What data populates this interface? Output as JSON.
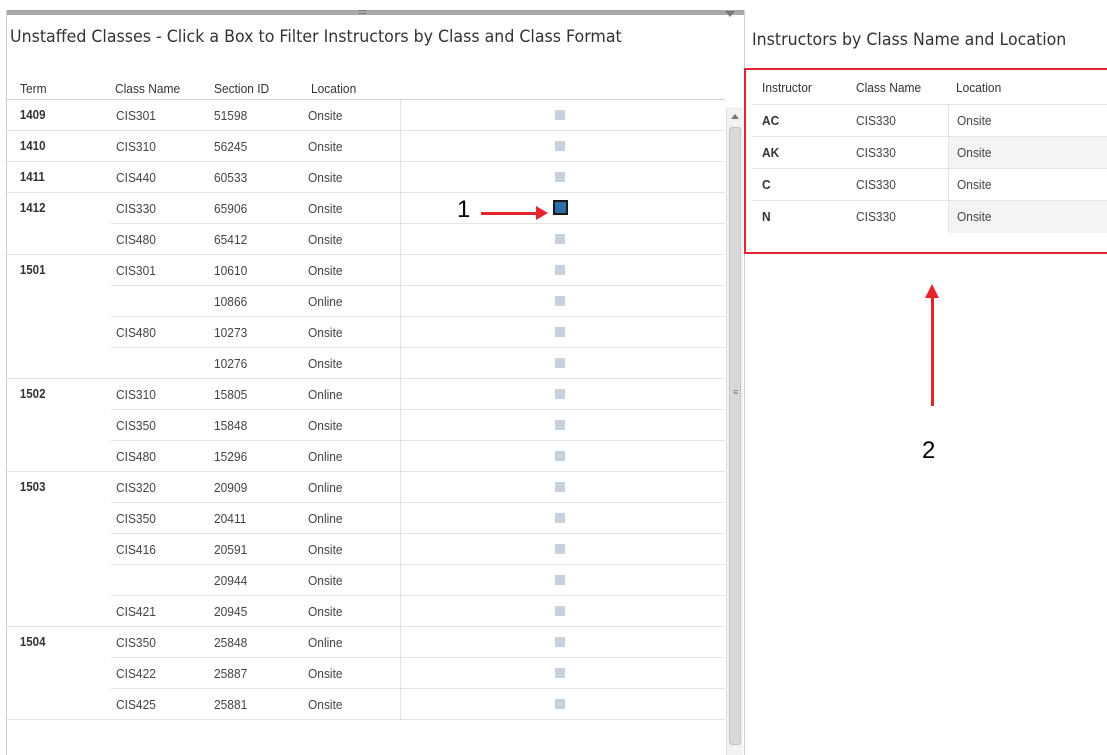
{
  "left_panel": {
    "title": "Unstaffed Classes - Click a Box to Filter Instructors by Class and Class Format",
    "headers": {
      "term": "Term",
      "class_name": "Class Name",
      "section_id": "Section ID",
      "location": "Location"
    },
    "term_groups": [
      {
        "term": "1409",
        "start": 0,
        "span": 1
      },
      {
        "term": "1410",
        "start": 1,
        "span": 1
      },
      {
        "term": "1411",
        "start": 2,
        "span": 1
      },
      {
        "term": "1412",
        "start": 3,
        "span": 2
      },
      {
        "term": "1501",
        "start": 5,
        "span": 4
      },
      {
        "term": "1502",
        "start": 9,
        "span": 3
      },
      {
        "term": "1503",
        "start": 12,
        "span": 5
      },
      {
        "term": "1504",
        "start": 17,
        "span": 3
      }
    ],
    "rows": [
      {
        "class_name": "CIS301",
        "section_id": "51598",
        "location": "Onsite",
        "selected": false
      },
      {
        "class_name": "CIS310",
        "section_id": "56245",
        "location": "Onsite",
        "selected": false
      },
      {
        "class_name": "CIS440",
        "section_id": "60533",
        "location": "Onsite",
        "selected": false
      },
      {
        "class_name": "CIS330",
        "section_id": "65906",
        "location": "Onsite",
        "selected": true
      },
      {
        "class_name": "CIS480",
        "section_id": "65412",
        "location": "Onsite",
        "selected": false
      },
      {
        "class_name": "CIS301",
        "section_id": "10610",
        "location": "Onsite",
        "selected": false
      },
      {
        "class_name": "",
        "section_id": "10866",
        "location": "Online",
        "selected": false
      },
      {
        "class_name": "CIS480",
        "section_id": "10273",
        "location": "Onsite",
        "selected": false
      },
      {
        "class_name": "",
        "section_id": "10276",
        "location": "Onsite",
        "selected": false
      },
      {
        "class_name": "CIS310",
        "section_id": "15805",
        "location": "Online",
        "selected": false
      },
      {
        "class_name": "CIS350",
        "section_id": "15848",
        "location": "Onsite",
        "selected": false
      },
      {
        "class_name": "CIS480",
        "section_id": "15296",
        "location": "Online",
        "selected": false
      },
      {
        "class_name": "CIS320",
        "section_id": "20909",
        "location": "Online",
        "selected": false
      },
      {
        "class_name": "CIS350",
        "section_id": "20411",
        "location": "Online",
        "selected": false
      },
      {
        "class_name": "CIS416",
        "section_id": "20591",
        "location": "Onsite",
        "selected": false
      },
      {
        "class_name": "",
        "section_id": "20944",
        "location": "Onsite",
        "selected": false
      },
      {
        "class_name": "CIS421",
        "section_id": "20945",
        "location": "Onsite",
        "selected": false
      },
      {
        "class_name": "CIS350",
        "section_id": "25848",
        "location": "Online",
        "selected": false
      },
      {
        "class_name": "CIS422",
        "section_id": "25887",
        "location": "Onsite",
        "selected": false
      },
      {
        "class_name": "CIS425",
        "section_id": "25881",
        "location": "Onsite",
        "selected": false
      }
    ]
  },
  "right_panel": {
    "title": "Instructors by Class Name and Location",
    "headers": {
      "instructor": "Instructor",
      "class_name": "Class Name",
      "location": "Location"
    },
    "rows": [
      {
        "instructor": "AC",
        "class_name": "CIS330",
        "location": "Onsite"
      },
      {
        "instructor": "AK",
        "class_name": "CIS330",
        "location": "Onsite"
      },
      {
        "instructor": "C",
        "class_name": "CIS330",
        "location": "Onsite"
      },
      {
        "instructor": "N",
        "class_name": "CIS330",
        "location": "Onsite"
      }
    ]
  },
  "annotations": {
    "label_1": "1",
    "label_2": "2"
  },
  "colors": {
    "highlight_border": "#e5242b",
    "selected_mark": "#2a6fa8",
    "mark": "#c5d1dc"
  }
}
